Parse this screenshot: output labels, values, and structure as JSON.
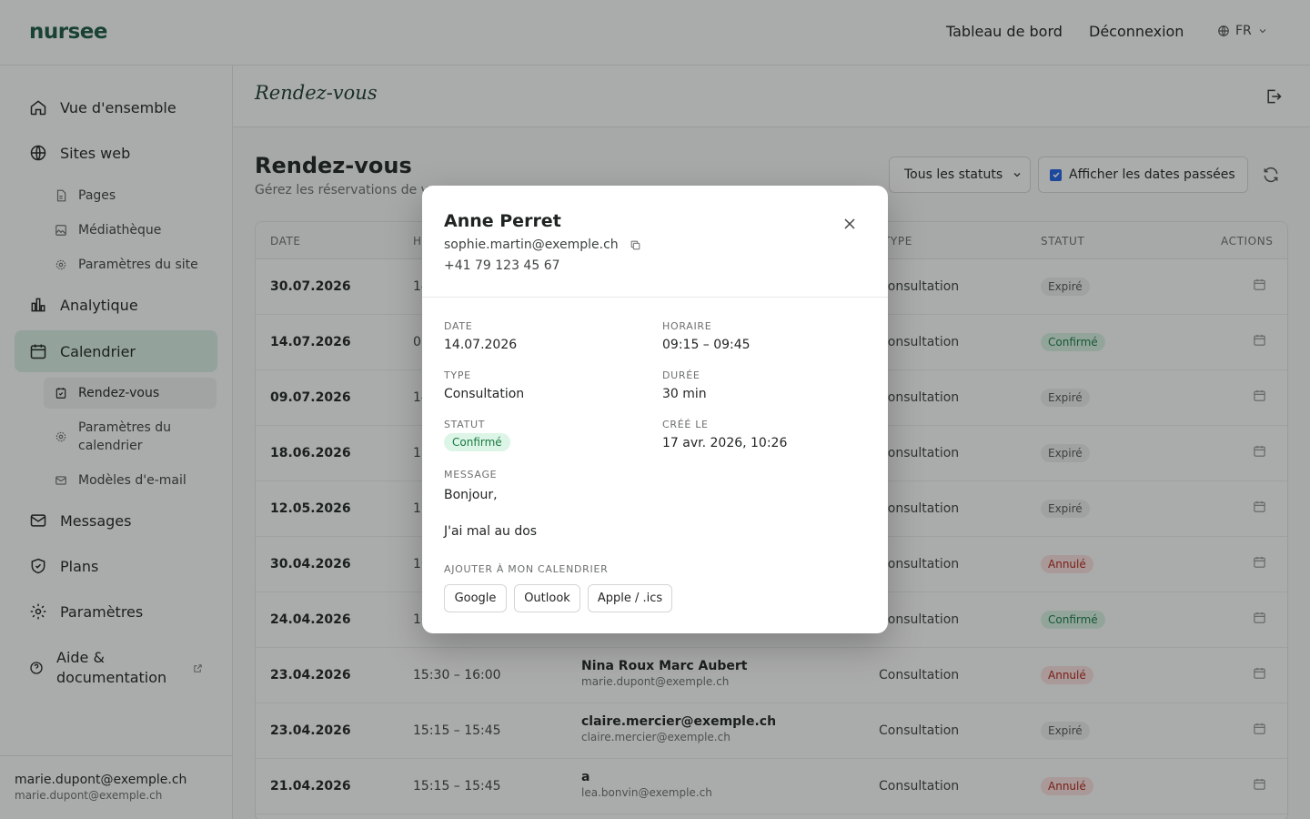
{
  "topbar": {
    "brand": "nursee",
    "links": [
      "Tableau de bord",
      "Déconnexion"
    ],
    "lang": "FR"
  },
  "sidebar": {
    "items": [
      {
        "label": "Vue d'ensemble",
        "icon": "home-icon"
      },
      {
        "label": "Sites web",
        "icon": "globe-icon"
      },
      {
        "label": "Analytique",
        "icon": "bar-chart-icon"
      },
      {
        "label": "Calendrier",
        "icon": "calendar-icon"
      },
      {
        "label": "Messages",
        "icon": "mail-icon"
      },
      {
        "label": "Plans",
        "icon": "shield-icon"
      },
      {
        "label": "Paramètres",
        "icon": "gear-icon"
      },
      {
        "label": "Aide & documentation",
        "icon": "help-circle-icon"
      }
    ],
    "sites_sub": [
      "Pages",
      "Médiathèque",
      "Paramètres du site"
    ],
    "calendar_sub": [
      "Rendez-vous",
      "Paramètres du calendrier",
      "Modèles d'e-mail"
    ],
    "footer": {
      "name": "marie.dupont@exemple.ch",
      "email": "marie.dupont@exemple.ch"
    }
  },
  "page": {
    "header_title": "Rendez-vous",
    "title": "Rendez-vous",
    "subtitle": "Gérez les réservations de v",
    "status_filter": "Tous les statuts",
    "show_past_label": "Afficher les dates passées",
    "show_past_checked": true
  },
  "table": {
    "headers": [
      "DATE",
      "H",
      "TYPE",
      "STATUT",
      "ACTIONS"
    ],
    "rows": [
      {
        "date": "30.07.2026",
        "time": "14",
        "client": "",
        "email": "",
        "type": "Consultation",
        "status": "Expiré",
        "status_kind": "expired"
      },
      {
        "date": "14.07.2026",
        "time": "0",
        "client": "",
        "email": "",
        "type": "Consultation",
        "status": "Confirmé",
        "status_kind": "confirmed"
      },
      {
        "date": "09.07.2026",
        "time": "14",
        "client": "",
        "email": "",
        "type": "Consultation",
        "status": "Expiré",
        "status_kind": "expired"
      },
      {
        "date": "18.06.2026",
        "time": "15",
        "client": "",
        "email": "",
        "type": "Consultation",
        "status": "Expiré",
        "status_kind": "expired"
      },
      {
        "date": "12.05.2026",
        "time": "11",
        "client": "",
        "email": "",
        "type": "Consultation",
        "status": "Expiré",
        "status_kind": "expired"
      },
      {
        "date": "30.04.2026",
        "time": "16",
        "client": "",
        "email": "",
        "type": "Consultation",
        "status": "Annulé",
        "status_kind": "cancelled"
      },
      {
        "date": "24.04.2026",
        "time": "16",
        "client": "",
        "email": "",
        "type": "Consultation",
        "status": "Confirmé",
        "status_kind": "confirmed"
      },
      {
        "date": "23.04.2026",
        "time": "15:30 – 16:00",
        "client": "Nina Roux Marc Aubert",
        "email": "marie.dupont@exemple.ch",
        "type": "Consultation",
        "status": "Annulé",
        "status_kind": "cancelled"
      },
      {
        "date": "23.04.2026",
        "time": "15:15 – 15:45",
        "client": "claire.mercier@exemple.ch",
        "email": "claire.mercier@exemple.ch",
        "type": "Consultation",
        "status": "Expiré",
        "status_kind": "expired"
      },
      {
        "date": "21.04.2026",
        "time": "15:15 – 15:45",
        "client": "a",
        "email": "lea.bonvin@exemple.ch",
        "type": "Consultation",
        "status": "Annulé",
        "status_kind": "cancelled"
      }
    ]
  },
  "modal": {
    "name": "Anne Perret",
    "email": "sophie.martin@exemple.ch",
    "phone": "+41 79 123 45 67",
    "date_label": "DATE",
    "date": "14.07.2026",
    "time_label": "HORAIRE",
    "time": "09:15 – 09:45",
    "type_label": "TYPE",
    "type": "Consultation",
    "duration_label": "DURÉE",
    "duration": "30 min",
    "status_label": "STATUT",
    "status": "Confirmé",
    "created_label": "CRÉÉ LE",
    "created": "17 avr. 2026, 10:26",
    "message_label": "MESSAGE",
    "message_line1": "Bonjour,",
    "message_line2": "J'ai mal au dos",
    "calendar_label": "AJOUTER À MON CALENDRIER",
    "calendar_buttons": [
      "Google",
      "Outlook",
      "Apple / .ics"
    ]
  },
  "colors": {
    "brand": "#1d5a46",
    "active_nav": "#dcefe6",
    "confirmed": "#1a7a45",
    "cancelled": "#b42318"
  }
}
